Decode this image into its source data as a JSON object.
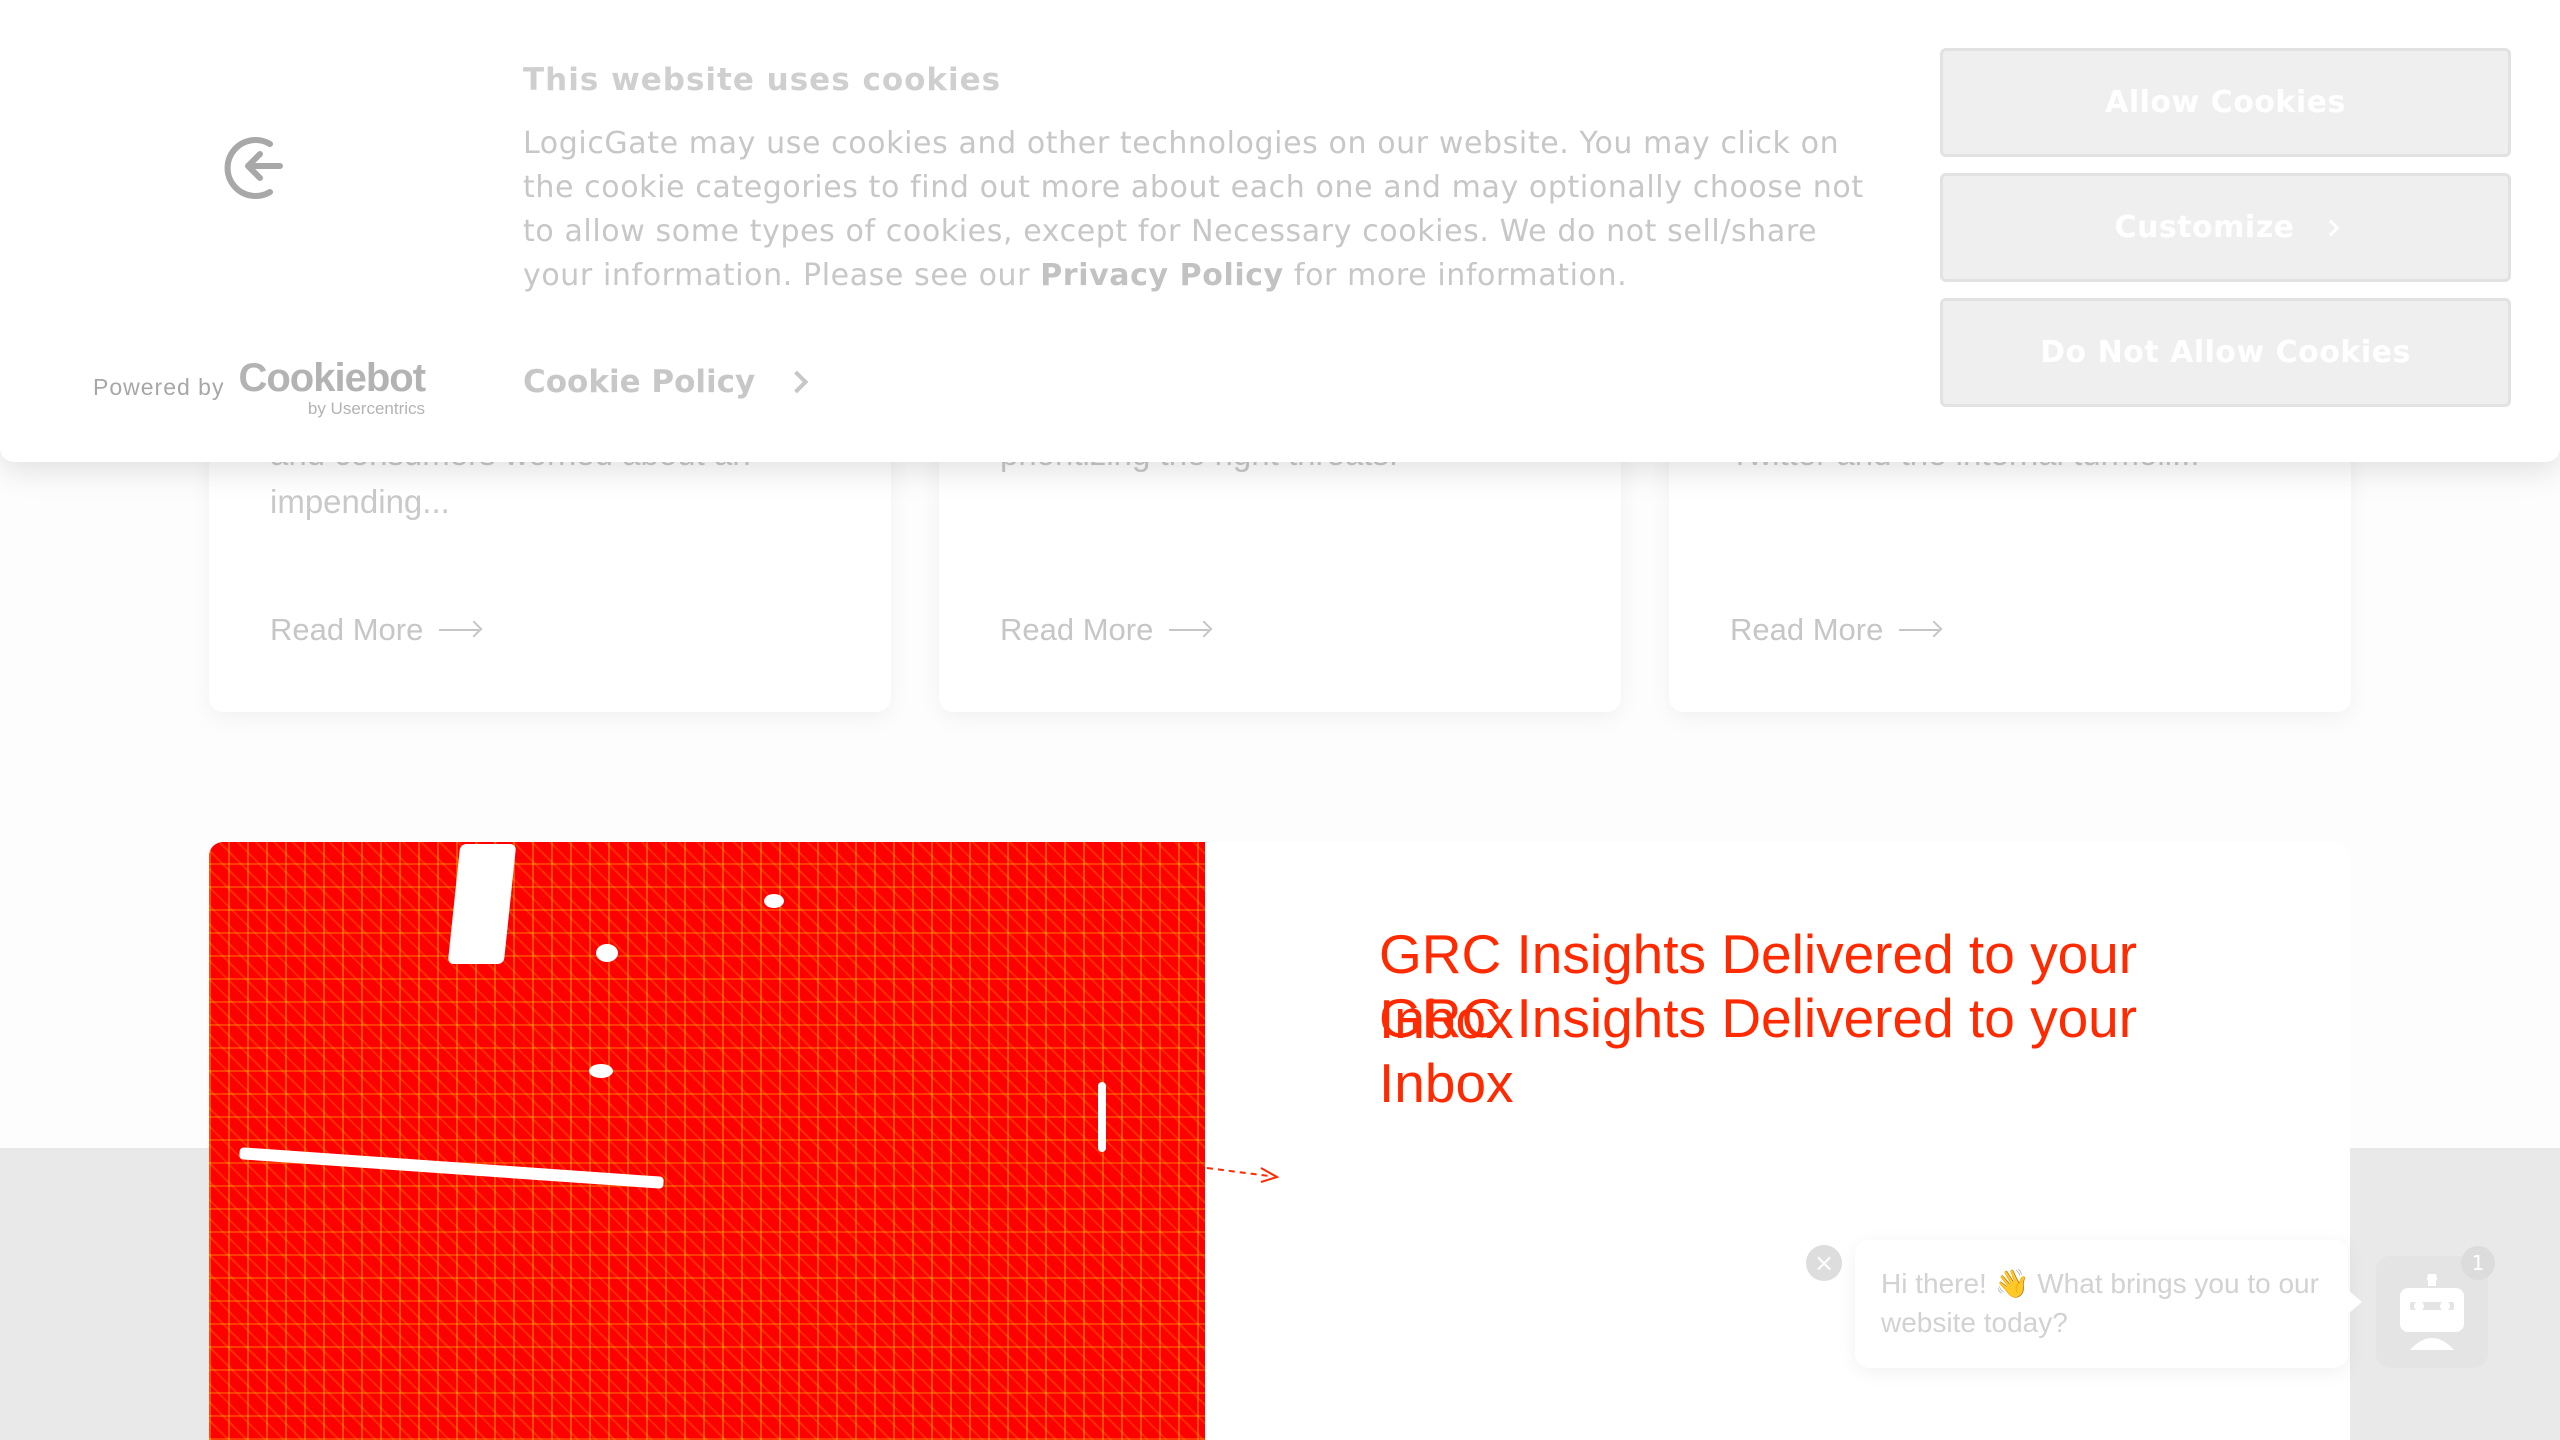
{
  "cookie_banner": {
    "title": "This website uses cookies",
    "body_text": "LogicGate may use cookies and other technologies on our website. You may click on the cookie categories to find out more about each one and may optionally choose not to allow some types of cookies, except for Necessary cookies.  We do not sell/share your information. Please see our ",
    "privacy_link": "Privacy Policy",
    "body_suffix": " for more information.",
    "cookie_policy_link": "Cookie Policy",
    "powered_by": "Powered by",
    "brand_name": "Cookiebot",
    "brand_sub": "by Usercentrics",
    "buttons": {
      "allow": "Allow Cookies",
      "customize": "Customize",
      "deny": "Do Not Allow Cookies"
    }
  },
  "cards": [
    {
      "excerpt": "and consumers worried about an impending...",
      "read_more": "Read More"
    },
    {
      "excerpt": "prioritizing the right threats.",
      "read_more": "Read More"
    },
    {
      "excerpt": "Twitter and the internal turmoil...",
      "read_more": "Read More"
    }
  ],
  "newsletter": {
    "title": "GRC Insights Delivered to your Inbox"
  },
  "chat": {
    "greeting": "Hi there! 👋 What brings you to our website today?",
    "badge_count": "1",
    "close_label": "×"
  },
  "colors": {
    "accent_red": "#ff2a00",
    "image_fill": "#ff0000",
    "button_fill": "#efefef"
  },
  "icons": [
    "cookie-logo-icon",
    "chevron-right-icon",
    "arrow-right-icon",
    "close-icon",
    "chatbot-icon"
  ]
}
